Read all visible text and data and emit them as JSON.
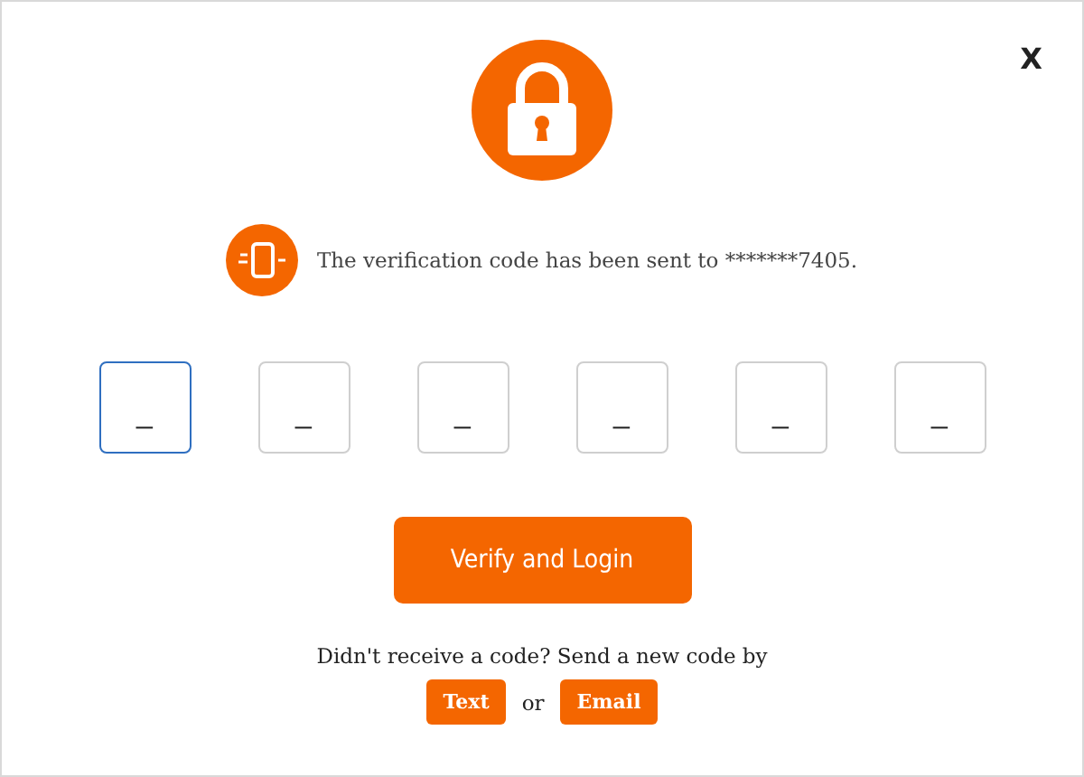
{
  "close": "X",
  "message": "The verification code has been sent to *******7405.",
  "code_fields": [
    {
      "placeholder": "_",
      "selected": true
    },
    {
      "placeholder": "_",
      "selected": false
    },
    {
      "placeholder": "_",
      "selected": false
    },
    {
      "placeholder": "_",
      "selected": false
    },
    {
      "placeholder": "_",
      "selected": false
    },
    {
      "placeholder": "_",
      "selected": false
    }
  ],
  "verify_button": "Verify and Login",
  "resend_prompt": "Didn't receive a code? Send a new code by",
  "resend_options": [
    "Text",
    "Email"
  ],
  "resend_separator": "or"
}
